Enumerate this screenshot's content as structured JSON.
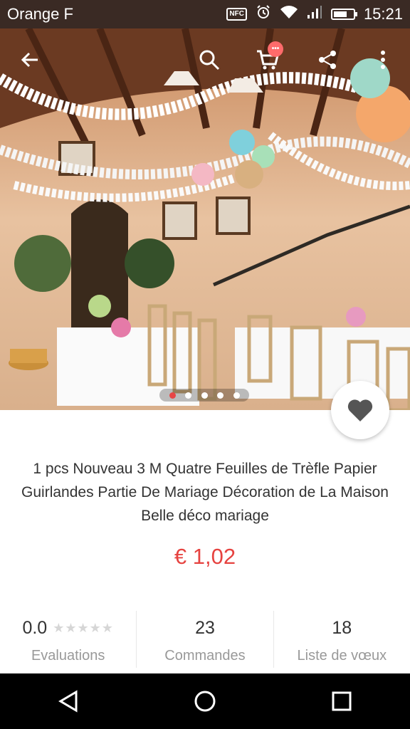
{
  "status_bar": {
    "carrier": "Orange F",
    "nfc": "NFC",
    "time": "15:21",
    "battery_level": 0.7
  },
  "toolbar": {
    "back_icon": "arrow-left-icon",
    "search_icon": "search-icon",
    "cart_icon": "cart-icon",
    "cart_badge": "•••",
    "share_icon": "share-icon",
    "more_icon": "more-vert-icon"
  },
  "gallery": {
    "image_count": 5,
    "active_index": 0
  },
  "favorite_icon": "heart-icon",
  "product": {
    "title": "1 pcs Nouveau 3 M Quatre Feuilles de Trèfle Papier Guirlandes Partie De Mariage Décoration de La Maison Belle déco mariage",
    "price": "€ 1,02"
  },
  "stats": {
    "rating_value": "0.0",
    "rating_stars": "★★★★★",
    "rating_label": "Evaluations",
    "orders_value": "23",
    "orders_label": "Commandes",
    "wishlist_value": "18",
    "wishlist_label": "Liste de vœux"
  },
  "nav": {
    "back": "triangle-back-icon",
    "home": "circle-home-icon",
    "recents": "square-recents-icon"
  },
  "colors": {
    "status_bar": "#3a2a24",
    "price": "#e64340",
    "dot_active": "#e84545"
  }
}
